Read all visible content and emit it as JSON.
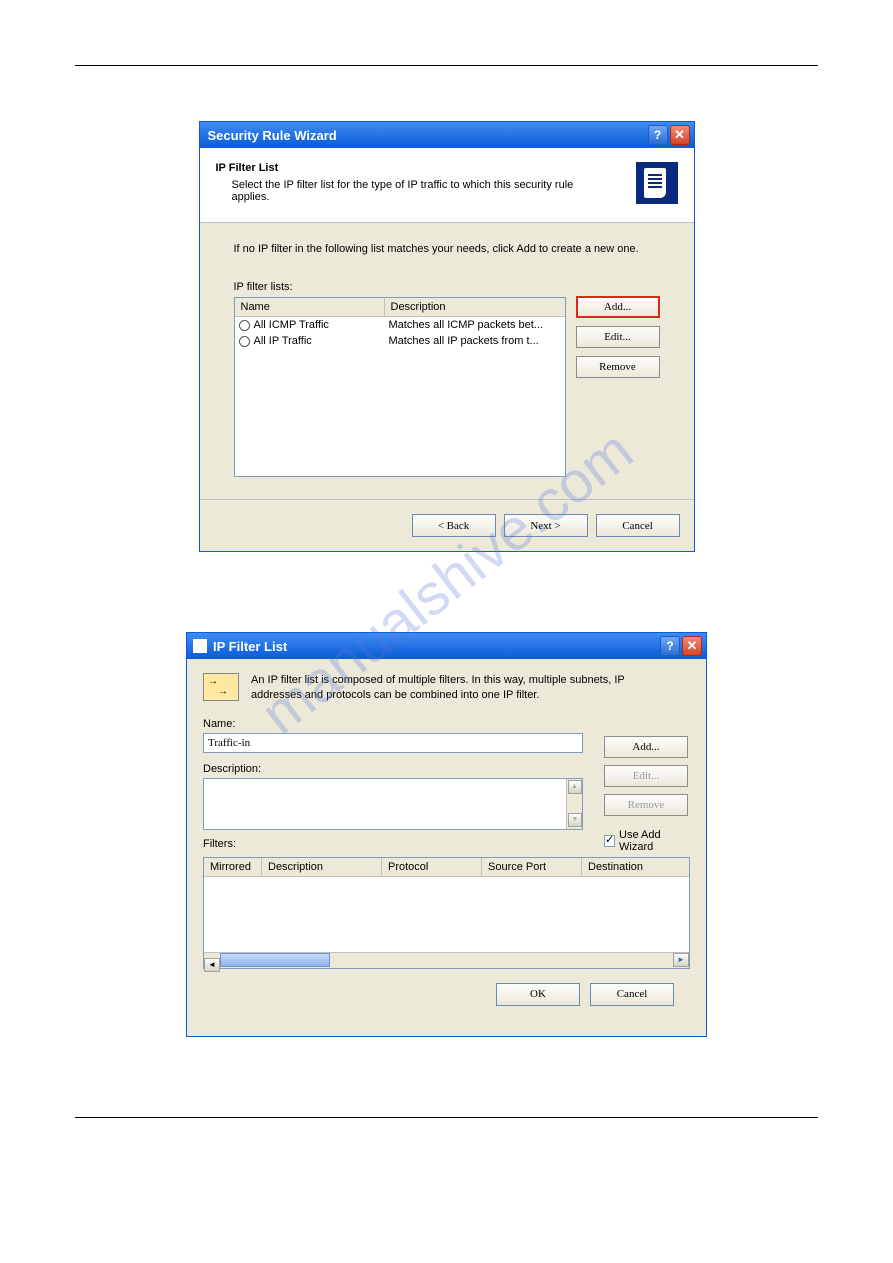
{
  "watermark": "manualshive.com",
  "dlg1": {
    "title": "Security Rule Wizard",
    "hdr_title": "IP Filter List",
    "hdr_sub": "Select the IP filter list for the type of IP traffic to which this security rule applies.",
    "instruction": "If no IP filter in the following list matches your needs, click Add to create a new one.",
    "list_label": "IP filter lists:",
    "cols": {
      "name": "Name",
      "desc": "Description"
    },
    "rows": [
      {
        "name": "All ICMP Traffic",
        "desc": "Matches all ICMP packets bet..."
      },
      {
        "name": "All IP Traffic",
        "desc": "Matches all IP packets from t..."
      }
    ],
    "btns": {
      "add": "Add...",
      "edit": "Edit...",
      "remove": "Remove"
    },
    "footer": {
      "back": "< Back",
      "next": "Next >",
      "cancel": "Cancel"
    }
  },
  "dlg2": {
    "title": "IP Filter List",
    "intro": "An IP filter list is composed of multiple filters. In this way, multiple subnets, IP addresses and protocols can be combined into one IP filter.",
    "name_label": "Name:",
    "name_value": "Traffic-in",
    "desc_label": "Description:",
    "btns": {
      "add": "Add...",
      "edit": "Edit...",
      "remove": "Remove"
    },
    "use_wizard": "Use Add Wizard",
    "filters_label": "Filters:",
    "cols": {
      "mirrored": "Mirrored",
      "desc": "Description",
      "proto": "Protocol",
      "sport": "Source Port",
      "dest": "Destination"
    },
    "footer": {
      "ok": "OK",
      "cancel": "Cancel"
    }
  }
}
